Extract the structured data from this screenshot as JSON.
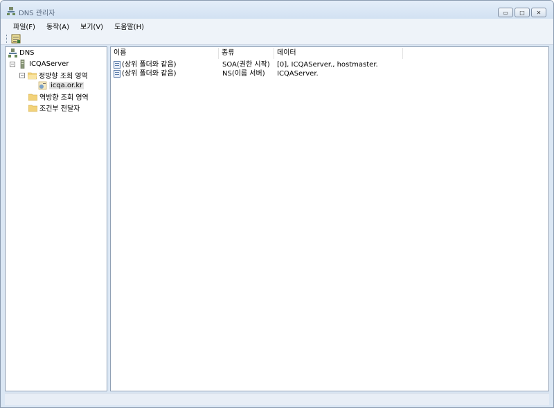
{
  "window": {
    "title": "DNS 관리자",
    "minimize": "▭",
    "maximize": "□",
    "close": "✕"
  },
  "menu": [
    "파일(F)",
    "동작(A)",
    "보기(V)",
    "도움말(H)"
  ],
  "tree": {
    "root": "DNS",
    "server": "ICQAServer",
    "forward_zone": "정방향 조회 영역",
    "zone": "icqa.or.kr",
    "reverse_zone": "역방향 조회 영역",
    "forwarders": "조건부 전달자"
  },
  "list": {
    "columns": [
      "이름",
      "종류",
      "데이터"
    ],
    "rows": [
      {
        "name": "(상위 폴더와 같음)",
        "type": "SOA(권한 시작)",
        "data": "[0], ICQAServer., hostmaster."
      },
      {
        "name": "(상위 폴더와 같음)",
        "type": "NS(이름 서버)",
        "data": "ICQAServer."
      }
    ]
  },
  "colors": {
    "selection": "#e3e3e3",
    "folder": "#f2d27a",
    "frame": "#dbe7f4"
  }
}
